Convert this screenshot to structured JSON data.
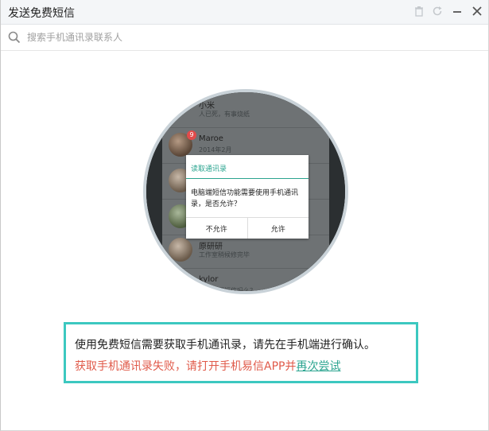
{
  "window": {
    "title": "发送免费短信"
  },
  "toolbar": {
    "icons": [
      "trash-icon",
      "refresh-icon",
      "minimize-icon",
      "close-icon"
    ]
  },
  "search": {
    "placeholder": "搜索手机通讯录联系人",
    "value": ""
  },
  "illustration": {
    "contacts": [
      {
        "name": "小米",
        "sub": "人已死，有事烧纸"
      },
      {
        "name": "Maroe",
        "sub": "2014年2月",
        "badge": "9"
      },
      {
        "name": "原研研",
        "sub": "工作室稍候修完毕"
      },
      {
        "name": "kylor",
        "sub": "我可以回短信吗么？"
      }
    ],
    "dialog": {
      "title": "读取通讯录",
      "body": "电脑端短信功能需要使用手机通讯录，是否允许？",
      "deny": "不允许",
      "allow": "允许"
    }
  },
  "message": {
    "line1": "使用免费短信需要获取手机通讯录，请先在手机端进行确认。",
    "line2_prefix": "获取手机通讯录失败，请打开手机易信APP并",
    "retry_link": "再次尝试"
  },
  "colors": {
    "accent": "#3cc8c0",
    "error": "#e05a4a",
    "link": "#2aa48f"
  }
}
